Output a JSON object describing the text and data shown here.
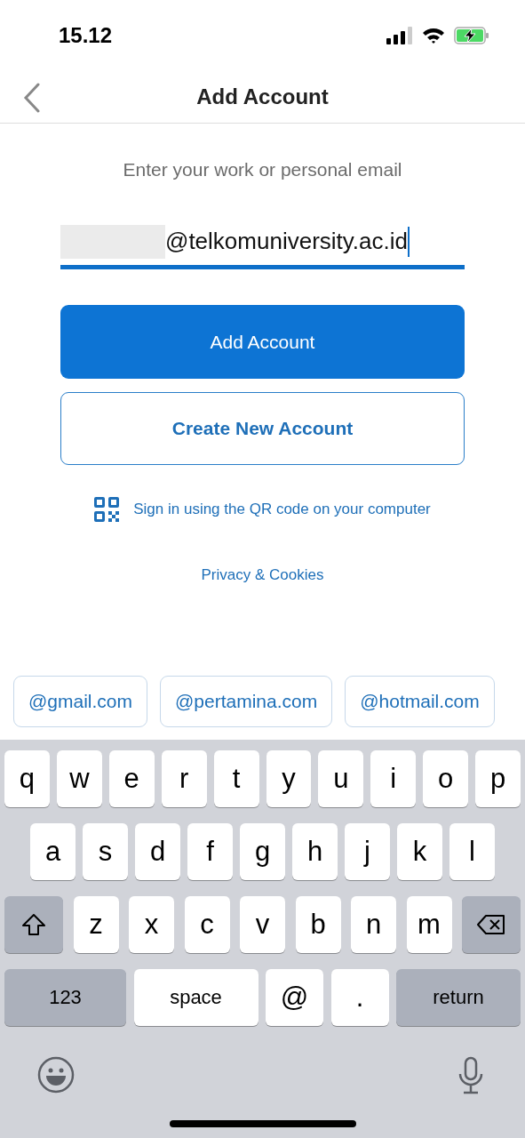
{
  "status_bar": {
    "time": "15.12"
  },
  "nav": {
    "title": "Add Account"
  },
  "form": {
    "prompt": "Enter your work or personal email",
    "email": {
      "value": "@telkomuniversity.ac.id",
      "redacted": true,
      "focused": true
    },
    "primary_button": "Add Account",
    "secondary_button": "Create New Account",
    "qr_link": "Sign in using the QR code on your computer",
    "privacy_link": "Privacy & Cookies"
  },
  "suggestions": [
    "@gmail.com",
    "@pertamina.com",
    "@hotmail.com"
  ],
  "keyboard": {
    "rows": [
      {
        "keys": [
          {
            "kind": "letter",
            "label": "q"
          },
          {
            "kind": "letter",
            "label": "w"
          },
          {
            "kind": "letter",
            "label": "e"
          },
          {
            "kind": "letter",
            "label": "r"
          },
          {
            "kind": "letter",
            "label": "t"
          },
          {
            "kind": "letter",
            "label": "y"
          },
          {
            "kind": "letter",
            "label": "u"
          },
          {
            "kind": "letter",
            "label": "i"
          },
          {
            "kind": "letter",
            "label": "o"
          },
          {
            "kind": "letter",
            "label": "p"
          }
        ]
      },
      {
        "keys": [
          {
            "kind": "letter",
            "label": "a"
          },
          {
            "kind": "letter",
            "label": "s"
          },
          {
            "kind": "letter",
            "label": "d"
          },
          {
            "kind": "letter",
            "label": "f"
          },
          {
            "kind": "letter",
            "label": "g"
          },
          {
            "kind": "letter",
            "label": "h"
          },
          {
            "kind": "letter",
            "label": "j"
          },
          {
            "kind": "letter",
            "label": "k"
          },
          {
            "kind": "letter",
            "label": "l"
          }
        ]
      },
      {
        "keys": [
          {
            "kind": "shift"
          },
          {
            "kind": "letter",
            "label": "z"
          },
          {
            "kind": "letter",
            "label": "x"
          },
          {
            "kind": "letter",
            "label": "c"
          },
          {
            "kind": "letter",
            "label": "v"
          },
          {
            "kind": "letter",
            "label": "b"
          },
          {
            "kind": "letter",
            "label": "n"
          },
          {
            "kind": "letter",
            "label": "m"
          },
          {
            "kind": "delete"
          }
        ]
      },
      {
        "keys": [
          {
            "kind": "numbers",
            "label": "123"
          },
          {
            "kind": "space",
            "label": "space"
          },
          {
            "kind": "symbol",
            "label": "@"
          },
          {
            "kind": "symbol",
            "label": "."
          },
          {
            "kind": "return",
            "label": "return"
          }
        ]
      }
    ]
  }
}
